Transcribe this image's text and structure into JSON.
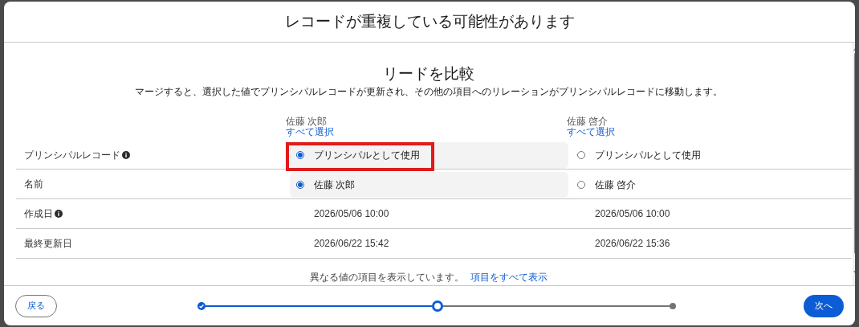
{
  "modal": {
    "title": "レコードが重複している可能性があります"
  },
  "heading": "リードを比較",
  "description": "マージすると、選択した値でプリンシパルレコードが更新され、その他の項目へのリレーションがプリンシパルレコードに移動します。",
  "records": [
    {
      "name": "佐藤 次郎",
      "select_all": "すべて選択"
    },
    {
      "name": "佐藤 啓介",
      "select_all": "すべて選択"
    }
  ],
  "rows": [
    {
      "label": "プリンシパルレコード",
      "info": true,
      "kind": "radio",
      "cells": [
        {
          "text": "プリンシパルとして使用",
          "selected": true,
          "highlighted": true
        },
        {
          "text": "プリンシパルとして使用",
          "selected": false,
          "highlighted": false
        }
      ]
    },
    {
      "label": "名前",
      "info": false,
      "kind": "radio",
      "cells": [
        {
          "text": "佐藤 次郎",
          "selected": true,
          "highlighted": false
        },
        {
          "text": "佐藤 啓介",
          "selected": false,
          "highlighted": false
        }
      ]
    },
    {
      "label": "作成日",
      "info": true,
      "kind": "text",
      "cells": [
        {
          "text": "2026/05/06 10:00"
        },
        {
          "text": "2026/05/06 10:00"
        }
      ]
    },
    {
      "label": "最終更新日",
      "info": false,
      "kind": "text",
      "cells": [
        {
          "text": "2026/06/22 15:42"
        },
        {
          "text": "2026/06/22 15:36"
        }
      ]
    }
  ],
  "footer_note": {
    "text": "異なる値の項目を表示しています。",
    "link": "項目をすべて表示"
  },
  "steps": [
    {
      "complete": true,
      "current": false
    },
    {
      "complete": false,
      "current": true
    },
    {
      "complete": false,
      "current": false
    }
  ],
  "back_button": "戻る",
  "next_button": "次へ"
}
